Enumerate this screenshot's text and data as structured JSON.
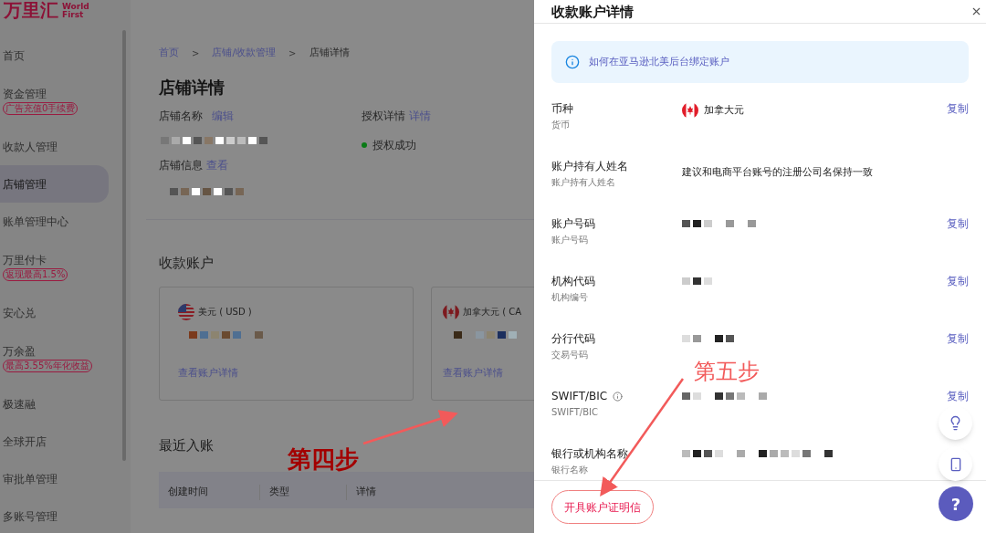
{
  "logo": {
    "name": "万里汇",
    "latin_top": "World",
    "latin_bottom": "First"
  },
  "sidebar": {
    "items": [
      {
        "label": "首页",
        "selected": false
      },
      {
        "label": "资金管理",
        "selected": false,
        "tag": "广告充值0手续费"
      },
      {
        "label": "收款人管理",
        "selected": false
      },
      {
        "label": "店铺管理",
        "selected": true
      },
      {
        "label": "账单管理中心",
        "selected": false
      },
      {
        "label": "万里付卡",
        "selected": false,
        "tag": "返现最高1.5%"
      },
      {
        "label": "安心兑",
        "selected": false
      },
      {
        "label": "万余盈",
        "selected": false,
        "tag": "最高3.55%年化收益"
      },
      {
        "label": "极速融",
        "selected": false
      },
      {
        "label": "全球开店",
        "selected": false
      },
      {
        "label": "审批单管理",
        "selected": false
      },
      {
        "label": "多账号管理",
        "selected": false
      }
    ]
  },
  "breadcrumb": [
    {
      "kind": "link",
      "text": "首页"
    },
    {
      "kind": "separator",
      "text": ">"
    },
    {
      "kind": "link",
      "text": "店铺/收款管理"
    },
    {
      "kind": "separator",
      "text": ">"
    },
    {
      "kind": "current",
      "text": "店铺详情"
    }
  ],
  "page_title": "店铺详情",
  "store": {
    "name_label": "店铺名称",
    "name_action": "编辑",
    "auth_label": "授权详情",
    "auth_action": "详情",
    "auth_status": "授权成功",
    "info_label": "店铺信息",
    "info_action": "查看"
  },
  "accounts": {
    "title": "收款账户",
    "cards": [
      {
        "kind": "usd",
        "currency": "美元 ( USD )",
        "link": "查看账户详情"
      },
      {
        "kind": "cad",
        "currency": "加拿大元 ( CA",
        "link": "查看账户详情"
      }
    ]
  },
  "recent": {
    "title": "最近入账",
    "columns": [
      "创建时间",
      "类型",
      "详情"
    ]
  },
  "drawer": {
    "title": "收款账户详情",
    "notice": "如何在亚马逊北美后台绑定账户",
    "rows": [
      {
        "kind": "currency",
        "label": "币种",
        "sublabel": "货币",
        "value": "加拿大元",
        "action": "复制"
      },
      {
        "kind": "text",
        "label": "账户持有人姓名",
        "sublabel": "账户持有人姓名",
        "value": "建议和电商平台账号的注册公司名保持一致"
      },
      {
        "kind": "redacted",
        "label": "账户号码",
        "sublabel": "账户号码",
        "action": "复制"
      },
      {
        "kind": "redacted",
        "label": "机构代码",
        "sublabel": "机构编号",
        "action": "复制"
      },
      {
        "kind": "redacted",
        "label": "分行代码",
        "sublabel": "交易号码",
        "action": "复制"
      },
      {
        "kind": "redacted",
        "label": "SWIFT/BIC",
        "sublabel": "SWIFT/BIC",
        "info": true,
        "action": "复制"
      },
      {
        "kind": "redacted",
        "label": "银行或机构名称",
        "sublabel": "银行名称"
      }
    ],
    "footer_button": "开具账户证明信",
    "help_button": "?"
  },
  "annotations": [
    "第四步",
    "第五步"
  ]
}
